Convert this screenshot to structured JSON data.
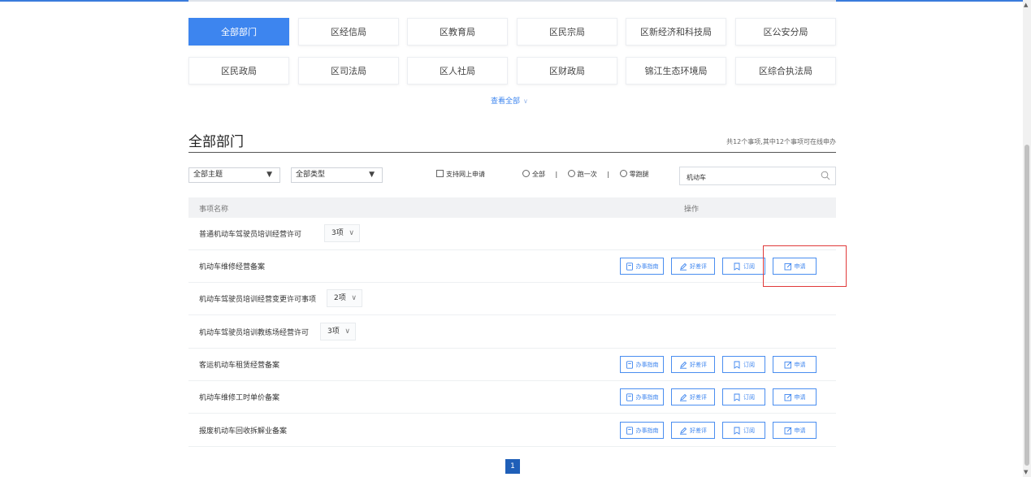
{
  "departments": [
    "全部部门",
    "区经信局",
    "区教育局",
    "区民宗局",
    "区新经济和科技局",
    "区公安分局",
    "区民政局",
    "区司法局",
    "区人社局",
    "区财政局",
    "锦江生态环境局",
    "区综合执法局"
  ],
  "view_all": "查看全部",
  "section": {
    "title": "全部部门",
    "count_text": "共12个事项,其中12个事项可在线申办"
  },
  "filters": {
    "theme": "全部主题",
    "type": "全部类型",
    "online_label": "支持网上申请",
    "radio_all": "全部",
    "radio_once": "跑一次",
    "radio_zero": "零跑腿",
    "search_value": "机动车"
  },
  "table": {
    "col_name": "事项名称",
    "col_action": "操作"
  },
  "actions": {
    "guide": "办事指南",
    "review": "好差评",
    "subscribe": "订阅",
    "apply": "申请"
  },
  "rows": [
    {
      "name": "普通机动车驾驶员培训经营许可",
      "badge": "3项"
    },
    {
      "name": "机动车维修经营备案"
    },
    {
      "name": "机动车驾驶员培训经营变更许可事项",
      "badge": "2项"
    },
    {
      "name": "机动车驾驶员培训教练场经营许可",
      "badge": "3项"
    },
    {
      "name": "客运机动车租赁经营备案"
    },
    {
      "name": "机动车维修工时单价备案"
    },
    {
      "name": "报废机动车回收拆解业备案"
    }
  ],
  "pagination": {
    "current": "1"
  },
  "colors": {
    "accent": "#3d85ef",
    "highlight": "#e03a3a",
    "page": "#1f5fb8"
  }
}
